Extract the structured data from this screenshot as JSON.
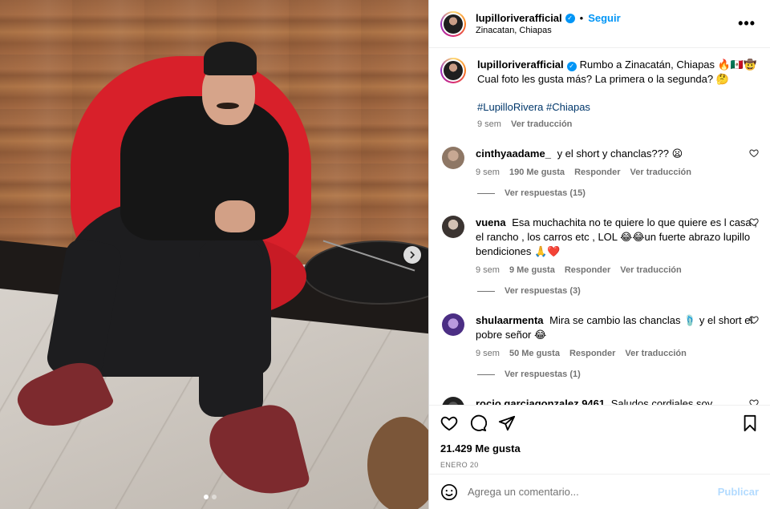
{
  "post": {
    "username": "lupilloriverafficial",
    "separator": "•",
    "follow_label": "Seguir",
    "location": "Zinacatan, Chiapas",
    "more_icon": "more-horizontal-icon",
    "verified_icon": "verified-badge-icon"
  },
  "photo": {
    "alt": "Lupillo Rivera sitting in a red egg chair",
    "carousel_current": 1,
    "carousel_total": 2,
    "next_icon": "chevron-right-icon"
  },
  "caption": {
    "username": "lupilloriverafficial",
    "text": "Rumbo a Zinacatán, Chiapas 🔥🇲🇽🤠 Cual foto les gusta más? La primera o la segunda? 🤔",
    "hashtags": "#LupilloRivera #Chiapas",
    "time": "9 sem",
    "translate": "Ver traducción"
  },
  "comments": [
    {
      "username": "cinthyaadame_",
      "text": "y el short y chanclas??? 😦",
      "time": "9 sem",
      "likes": "190 Me gusta",
      "reply": "Responder",
      "translate": "Ver traducción",
      "view_replies": "Ver respuestas (15)"
    },
    {
      "username": "vuena",
      "text": "Esa muchachita no te quiere lo que quiere es l casa , el rancho , los carros etc , LOL 😂😂un fuerte abrazo lupillo bendiciones 🙏❤️",
      "time": "9 sem",
      "likes": "9 Me gusta",
      "reply": "Responder",
      "translate": "Ver traducción",
      "view_replies": "Ver respuestas (3)"
    },
    {
      "username": "shulaarmenta",
      "text": "Mira se cambio las chanclas 🩴 y el short el pobre señor 😂",
      "time": "9 sem",
      "likes": "50 Me gusta",
      "reply": "Responder",
      "translate": "Ver traducción",
      "view_replies": "Ver respuestas (1)"
    },
    {
      "username": "rocio.garciagonzalez.9461",
      "text": "Saludos cordiales soy seguidora"
    }
  ],
  "actions": {
    "like_icon": "heart-icon",
    "comment_icon": "comment-bubble-icon",
    "share_icon": "paper-plane-icon",
    "save_icon": "bookmark-icon",
    "likes": "21.429 Me gusta",
    "date": "ENERO 20"
  },
  "add_comment": {
    "emoji_icon": "emoji-smiley-icon",
    "placeholder": "Agrega un comentario...",
    "publish_label": "Publicar"
  },
  "colors": {
    "accent": "#0095f6",
    "publish_disabled": "#b3dbff",
    "muted": "#737373",
    "hashtag": "#00376b"
  }
}
